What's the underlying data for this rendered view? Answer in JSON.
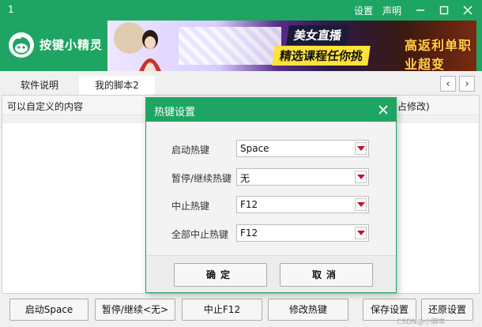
{
  "window": {
    "title": "1",
    "links": {
      "settings": "设置",
      "statement": "声明"
    }
  },
  "header": {
    "app_name": "按键小精灵",
    "banner": {
      "line1": "美女直播",
      "line2": "精选课程任你挑",
      "line3": "高返利单职业超变"
    }
  },
  "tabs": [
    {
      "label": "软件说明",
      "active": false
    },
    {
      "label": "我的脚本2",
      "active": true
    }
  ],
  "table": {
    "col_left": "可以自定义的内容",
    "col_right_partial": "占修改)"
  },
  "dialog": {
    "title": "热键设置",
    "fields": [
      {
        "label": "启动热键",
        "value": "Space"
      },
      {
        "label": "暂停/继续热键",
        "value": "无"
      },
      {
        "label": "中止热键",
        "value": "F12"
      },
      {
        "label": "全部中止热键",
        "value": "F12"
      }
    ],
    "ok": "确定",
    "cancel": "取消"
  },
  "bottom_buttons": {
    "start": "启动Space",
    "pause": "暂停/继续<无>",
    "stop": "中止F12",
    "edit_hotkeys": "修改热键",
    "save": "保存设置",
    "restore": "还原设置"
  },
  "watermark": "CSDN@小脚本",
  "colors": {
    "accent": "#1fa563",
    "dropdown_arrow": "#c8102e"
  }
}
